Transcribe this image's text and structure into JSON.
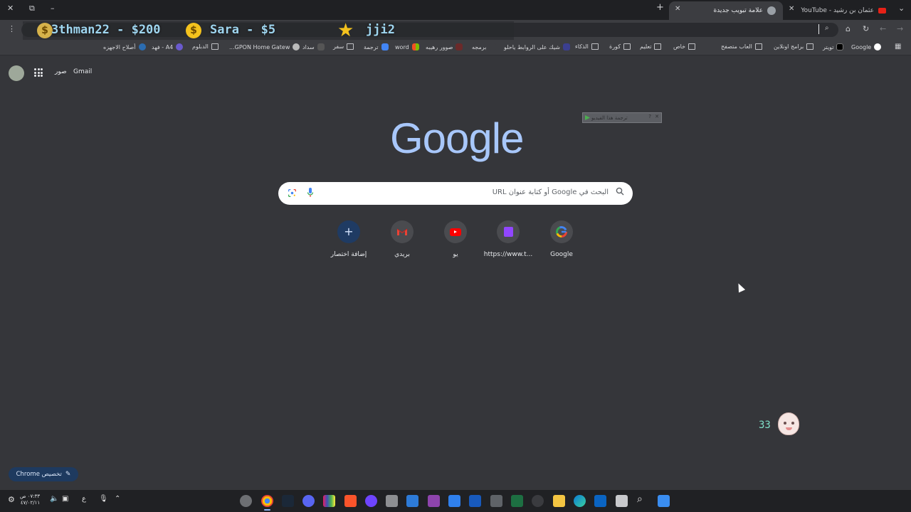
{
  "tabs": [
    {
      "label": "علامة تبويب جديدة",
      "active": true
    },
    {
      "label": "عثمان بن رشيد - YouTube",
      "active": false
    }
  ],
  "window": {
    "close": "✕",
    "restore": "⧉",
    "minimize": "–",
    "new_tab": "+",
    "tab_menu": "⌄"
  },
  "ticker": {
    "item1": "3thman22 - $200",
    "item2": "Sara - $5",
    "item3": "jji2",
    "coin_symbol": "$",
    "star_symbol": "★"
  },
  "bookmarks": [
    {
      "label": "Google",
      "icon": "google-icon"
    },
    {
      "label": "تويتر",
      "icon": "x-icon"
    },
    {
      "label": "برامج اونلاين",
      "icon": "folder-icon"
    },
    {
      "label": "العاب متصفح",
      "icon": "folder-icon"
    },
    {
      "label": "خاص",
      "icon": "folder-icon"
    },
    {
      "label": "تعليم",
      "icon": "folder-icon"
    },
    {
      "label": "كورة",
      "icon": "folder-icon"
    },
    {
      "label": "الذكاء",
      "icon": "folder-icon"
    },
    {
      "label": "شيك على الروابط ياحلو",
      "icon": "site-icon"
    },
    {
      "label": "برمجه",
      "icon": "site-icon"
    },
    {
      "label": "صوور رهيبه",
      "icon": "site-icon"
    },
    {
      "label": "word",
      "icon": "site-icon"
    },
    {
      "label": "ترجمة",
      "icon": "translate-icon"
    },
    {
      "label": "سفر",
      "icon": "folder-icon"
    },
    {
      "label": "سداد",
      "icon": "site-icon"
    },
    {
      "label": "GPON Home Gatew...",
      "icon": "globe-icon"
    },
    {
      "label": "الدبلوم",
      "icon": "folder-icon"
    },
    {
      "label": "A4 - فهد",
      "icon": "site-icon"
    },
    {
      "label": "أصلاح الاجهزه",
      "icon": "site-icon"
    }
  ],
  "ntp": {
    "gmail": "Gmail",
    "images": "صور",
    "logo": "Google",
    "translate_popup": "ترجمة هذا الفيديو",
    "search_placeholder": "البحث في Google أو كتابة عنوان URL",
    "customize": "تخصيص Chrome",
    "shortcuts": [
      {
        "label": "Google",
        "icon": "google-icon"
      },
      {
        "label": "https://www.t...",
        "icon": "twitch-icon"
      },
      {
        "label": "يو",
        "icon": "youtube-icon"
      },
      {
        "label": "بريدي",
        "icon": "gmail-icon"
      },
      {
        "label": "إضافة اختصار",
        "icon": "plus-icon"
      }
    ]
  },
  "overlay": {
    "count": "33"
  },
  "taskbar": {
    "time": "٠٧:٣٣ ص",
    "date": "٤٧/٠٢/١١",
    "lang": "ع"
  }
}
